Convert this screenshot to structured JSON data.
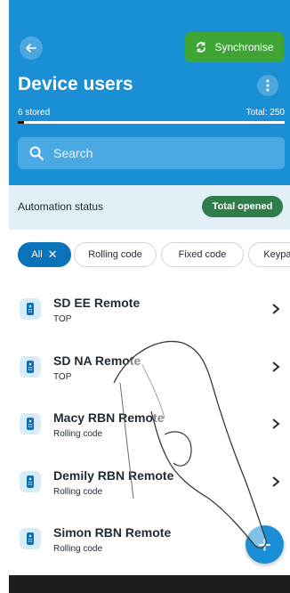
{
  "header": {
    "back_icon": "arrow-left-icon",
    "sync_label": "Synchronise",
    "sync_icon": "sync-icon",
    "title": "Device users",
    "more_icon": "more-vertical-icon",
    "stored": "6 stored",
    "total": "Total: 250",
    "progress_fraction": 0.024,
    "search_placeholder": "Search"
  },
  "status": {
    "label": "Automation status",
    "badge": "Total opened"
  },
  "filters": [
    {
      "label": "All",
      "active": true
    },
    {
      "label": "Rolling code",
      "active": false
    },
    {
      "label": "Fixed code",
      "active": false
    },
    {
      "label": "Keypad",
      "active": false
    }
  ],
  "users": [
    {
      "name": "SD EE Remote",
      "type": "TOP"
    },
    {
      "name": "SD NA Remote",
      "type": "TOP"
    },
    {
      "name": "Macy RBN Remote",
      "type": "Rolling code"
    },
    {
      "name": "Demily RBN Remote",
      "type": "Rolling code"
    },
    {
      "name": "Simon RBN Remote",
      "type": "Rolling code"
    }
  ],
  "fab": {
    "label": "+"
  },
  "colors": {
    "primary": "#1a8fd6",
    "sync_green": "#3ea535",
    "badge_green": "#2e7d4a",
    "chip_active": "#0a73b9"
  }
}
